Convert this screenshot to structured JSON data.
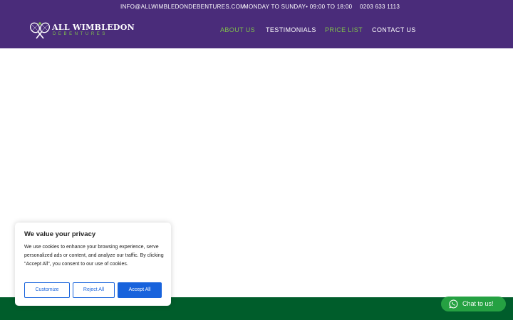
{
  "topbar": {
    "email": "INFO@ALLWIMBLEDONDEBENTURES.COM",
    "hours": "MONDAY TO SUNDAY• 09:00 TO 18:00",
    "phone": "0203 633 1113"
  },
  "logo": {
    "title": "ALL WIMBLEDON",
    "subtitle": "DEBENTURES",
    "icon": "crossed-rackets-icon"
  },
  "nav": {
    "items": [
      {
        "label": "ABOUT US",
        "color": "#7fbf4c"
      },
      {
        "label": "TESTIMONIALS",
        "color": "#ffffff"
      },
      {
        "label": "PRICE LIST",
        "color": "#7fbf4c"
      },
      {
        "label": "CONTACT US",
        "color": "#ffffff"
      }
    ]
  },
  "cookie": {
    "title": "We value your privacy",
    "text": "We use cookies to enhance your browsing experience, serve personalized ads or content, and analyze our traffic. By clicking \"Accept All\", you consent to our use of cookies.",
    "customize_label": "Customize",
    "reject_label": "Reject All",
    "accept_label": "Accept All"
  },
  "chat": {
    "label": "Chat to us!",
    "icon": "whatsapp-icon"
  },
  "colors": {
    "header_bg": "#4a2c7a",
    "accent_green": "#7fbf4c",
    "footer_green": "#005d2b",
    "button_blue": "#1863dc",
    "chat_green": "#25a142"
  }
}
